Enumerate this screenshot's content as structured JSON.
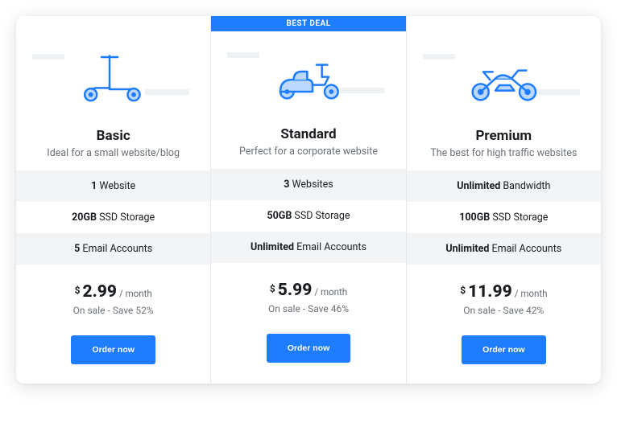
{
  "badge_label": "BEST DEAL",
  "currency": "$",
  "period": "/ month",
  "cta_label": "Order now",
  "plans": [
    {
      "title": "Basic",
      "subtitle": "Ideal for a small website/blog",
      "features": [
        {
          "bold": "1",
          "rest": " Website"
        },
        {
          "bold": "20GB",
          "rest": " SSD Storage"
        },
        {
          "bold": "5",
          "rest": " Email Accounts"
        }
      ],
      "price": "2.99",
      "sale": "On sale - Save 52%",
      "icon": "scooter"
    },
    {
      "title": "Standard",
      "subtitle": "Perfect for a corporate website",
      "features": [
        {
          "bold": "3",
          "rest": " Websites"
        },
        {
          "bold": "50GB",
          "rest": " SSD Storage"
        },
        {
          "bold": "Unlimited",
          "rest": " Email Accounts"
        }
      ],
      "price": "5.99",
      "sale": "On sale - Save 46%",
      "icon": "moped",
      "badge": true
    },
    {
      "title": "Premium",
      "subtitle": "The best for high traffic websites",
      "features": [
        {
          "bold": "Unlimited",
          "rest": " Bandwidth"
        },
        {
          "bold": "100GB",
          "rest": " SSD Storage"
        },
        {
          "bold": "Unlimited",
          "rest": " Email Accounts"
        }
      ],
      "price": "11.99",
      "sale": "On sale - Save 42%",
      "icon": "motorcycle"
    }
  ],
  "colors": {
    "accent": "#1e7cff",
    "icon_fill": "#bcd8ff",
    "icon_stroke": "#1e7cff"
  }
}
